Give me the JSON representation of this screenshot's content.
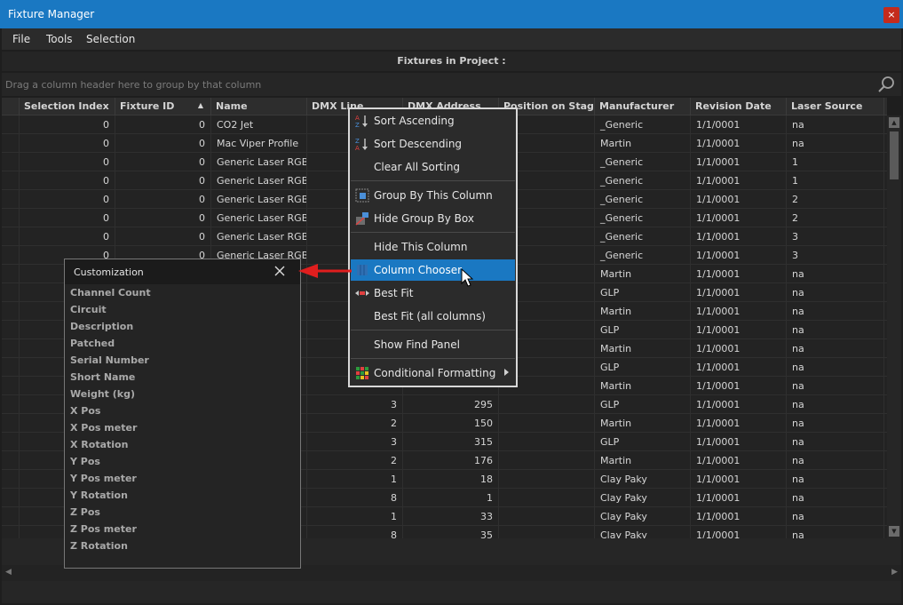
{
  "window": {
    "title": "Fixture Manager",
    "close_glyph": "×"
  },
  "menu_bar": {
    "items": [
      "File",
      "Tools",
      "Selection"
    ]
  },
  "caption": "Fixtures in Project :",
  "group_box": {
    "hint": "Drag a column header here to group by that column",
    "search_icon": "search-icon"
  },
  "grid": {
    "columns": [
      "Selection Index",
      "Fixture ID",
      "Name",
      "DMX Line",
      "DMX Address",
      "Position on Stage",
      "Manufacturer",
      "Revision Date",
      "Laser Source"
    ],
    "sort_indicator": "▲",
    "rows": [
      [
        "0",
        "0",
        "CO2 Jet",
        "",
        "",
        "",
        "_Generic",
        "1/1/0001",
        "na"
      ],
      [
        "0",
        "0",
        "Mac Viper Profile",
        "",
        "",
        "",
        "Martin",
        "1/1/0001",
        "na"
      ],
      [
        "0",
        "0",
        "Generic Laser RGB ...",
        "",
        "",
        "",
        "_Generic",
        "1/1/0001",
        "1"
      ],
      [
        "0",
        "0",
        "Generic Laser RGB ...",
        "",
        "",
        "",
        "_Generic",
        "1/1/0001",
        "1"
      ],
      [
        "0",
        "0",
        "Generic Laser RGB ...",
        "",
        "",
        "",
        "_Generic",
        "1/1/0001",
        "2"
      ],
      [
        "0",
        "0",
        "Generic Laser RGB ...",
        "",
        "",
        "",
        "_Generic",
        "1/1/0001",
        "2"
      ],
      [
        "0",
        "0",
        "Generic Laser RGB ...",
        "",
        "",
        "",
        "_Generic",
        "1/1/0001",
        "3"
      ],
      [
        "0",
        "0",
        "Generic Laser RGB ...",
        "",
        "",
        "",
        "_Generic",
        "1/1/0001",
        "3"
      ],
      [
        "",
        "",
        "",
        "",
        "",
        "",
        "Martin",
        "1/1/0001",
        "na"
      ],
      [
        "",
        "",
        "",
        "",
        "",
        "",
        "GLP",
        "1/1/0001",
        "na"
      ],
      [
        "",
        "",
        "",
        "",
        "",
        "",
        "Martin",
        "1/1/0001",
        "na"
      ],
      [
        "",
        "",
        "",
        "",
        "",
        "",
        "GLP",
        "1/1/0001",
        "na"
      ],
      [
        "",
        "",
        "",
        "",
        "",
        "",
        "Martin",
        "1/1/0001",
        "na"
      ],
      [
        "",
        "",
        "",
        "",
        "",
        "",
        "GLP",
        "1/1/0001",
        "na"
      ],
      [
        "",
        "",
        "",
        "",
        "",
        "",
        "Martin",
        "1/1/0001",
        "na"
      ],
      [
        "",
        "",
        "",
        "3",
        "295",
        "",
        "GLP",
        "1/1/0001",
        "na"
      ],
      [
        "",
        "",
        "",
        "2",
        "150",
        "",
        "Martin",
        "1/1/0001",
        "na"
      ],
      [
        "",
        "",
        "",
        "3",
        "315",
        "",
        "GLP",
        "1/1/0001",
        "na"
      ],
      [
        "",
        "",
        "",
        "2",
        "176",
        "",
        "Martin",
        "1/1/0001",
        "na"
      ],
      [
        "",
        "",
        "",
        "1",
        "18",
        "",
        "Clay Paky",
        "1/1/0001",
        "na"
      ],
      [
        "",
        "",
        "",
        "8",
        "1",
        "",
        "Clay Paky",
        "1/1/0001",
        "na"
      ],
      [
        "",
        "",
        "",
        "1",
        "33",
        "",
        "Clay Paky",
        "1/1/0001",
        "na"
      ],
      [
        "",
        "",
        "",
        "8",
        "35",
        "",
        "Clay Paky",
        "1/1/0001",
        "na"
      ]
    ]
  },
  "context_menu": {
    "items": [
      {
        "label": "Sort Ascending",
        "icon": "sort-ascending-icon"
      },
      {
        "label": "Sort Descending",
        "icon": "sort-descending-icon"
      },
      {
        "label": "Clear All Sorting",
        "icon": ""
      },
      {
        "label": "Group By This Column",
        "icon": "group-by-icon"
      },
      {
        "label": "Hide Group By Box",
        "icon": "hide-group-box-icon"
      },
      {
        "label": "Hide This Column",
        "icon": ""
      },
      {
        "label": "Column Chooser",
        "icon": "column-chooser-icon",
        "selected": true
      },
      {
        "label": "Best Fit",
        "icon": "best-fit-icon"
      },
      {
        "label": "Best Fit (all columns)",
        "icon": ""
      },
      {
        "label": "Show Find Panel",
        "icon": ""
      },
      {
        "label": "Conditional Formatting",
        "icon": "conditional-formatting-icon",
        "submenu": true
      }
    ]
  },
  "customization": {
    "title": "Customization",
    "columns": [
      "Channel Count",
      "Circuit",
      "Description",
      "Patched",
      "Serial Number",
      "Short Name",
      "Weight (kg)",
      "X Pos",
      "X Pos meter",
      "X Rotation",
      "Y Pos",
      "Y Pos meter",
      "Y Rotation",
      "Z Pos",
      "Z Pos meter",
      "Z Rotation"
    ]
  },
  "colors": {
    "accent": "#1a78c2",
    "background": "#1e1e1e",
    "arrow": "#e01e1e",
    "close": "#c42b1c"
  }
}
